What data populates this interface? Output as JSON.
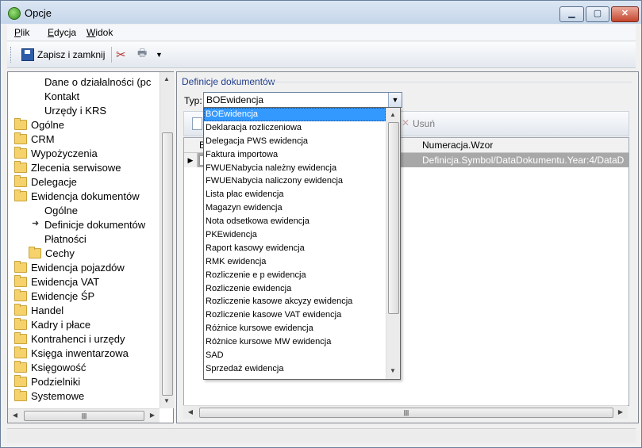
{
  "window": {
    "title": "Opcje"
  },
  "menu": [
    {
      "accel": "P",
      "rest": "lik"
    },
    {
      "accel": "E",
      "rest": "dycja"
    },
    {
      "accel": "W",
      "rest": "idok"
    }
  ],
  "toolbar": {
    "save_label": "Zapisz i zamknij"
  },
  "tree": {
    "items": [
      {
        "label": "Dane o działalności (pc",
        "level": 2,
        "folder": false
      },
      {
        "label": "Kontakt",
        "level": 2,
        "folder": false
      },
      {
        "label": "Urzędy i KRS",
        "level": 2,
        "folder": false
      },
      {
        "label": "Ogólne",
        "level": 0,
        "folder": true
      },
      {
        "label": "CRM",
        "level": 0,
        "folder": true
      },
      {
        "label": "Wypożyczenia",
        "level": 0,
        "folder": true
      },
      {
        "label": "Zlecenia serwisowe",
        "level": 0,
        "folder": true
      },
      {
        "label": "Delegacje",
        "level": 0,
        "folder": true
      },
      {
        "label": "Ewidencja dokumentów",
        "level": 0,
        "folder": true
      },
      {
        "label": "Ogólne",
        "level": 2,
        "folder": false
      },
      {
        "label": "Definicje dokumentów",
        "level": 2,
        "folder": false,
        "current": true
      },
      {
        "label": "Płatności",
        "level": 2,
        "folder": false
      },
      {
        "label": "Cechy",
        "level": 1,
        "folder": true
      },
      {
        "label": "Ewidencja pojazdów",
        "level": 0,
        "folder": true
      },
      {
        "label": "Ewidencja VAT",
        "level": 0,
        "folder": true
      },
      {
        "label": "Ewidencje ŚP",
        "level": 0,
        "folder": true
      },
      {
        "label": "Handel",
        "level": 0,
        "folder": true
      },
      {
        "label": "Kadry i płace",
        "level": 0,
        "folder": true
      },
      {
        "label": "Kontrahenci i urzędy",
        "level": 0,
        "folder": true
      },
      {
        "label": "Księga inwentarzowa",
        "level": 0,
        "folder": true
      },
      {
        "label": "Księgowość",
        "level": 0,
        "folder": true
      },
      {
        "label": "Podzielniki",
        "level": 0,
        "folder": true
      },
      {
        "label": "Systemowe",
        "level": 0,
        "folder": true
      }
    ]
  },
  "right": {
    "group_title": "Definicje dokumentów",
    "typ_label": "Typ:",
    "typ_value": "BOEwidencja",
    "delete_label": "Usuń",
    "grid": {
      "first_col_header": "B",
      "col_header": "Numeracja.Wzor",
      "row_value": "Definicja.Symbol/DataDokumentu.Year:4/DataD"
    }
  },
  "dropdown": {
    "selected_index": 0,
    "options": [
      "BOEwidencja",
      "Deklaracja rozliczeniowa",
      "Delegacja PWS ewidencja",
      "Faktura importowa",
      "FWUENabycia należny ewidencja",
      "FWUENabycia naliczony ewidencja",
      "Lista płac ewidencja",
      "Magazyn ewidencja",
      "Nota odsetkowa ewidencja",
      "PKEwidencja",
      "Raport kasowy ewidencja",
      "RMK ewidencja",
      "Rozliczenie e p ewidencja",
      "Rozliczenie ewidencja",
      "Rozliczenie kasowe akcyzy ewidencja",
      "Rozliczenie kasowe VAT ewidencja",
      "Różnice kursowe ewidencja",
      "Różnice kursowe MW ewidencja",
      "SAD",
      "Sprzedaż ewidencja"
    ]
  }
}
